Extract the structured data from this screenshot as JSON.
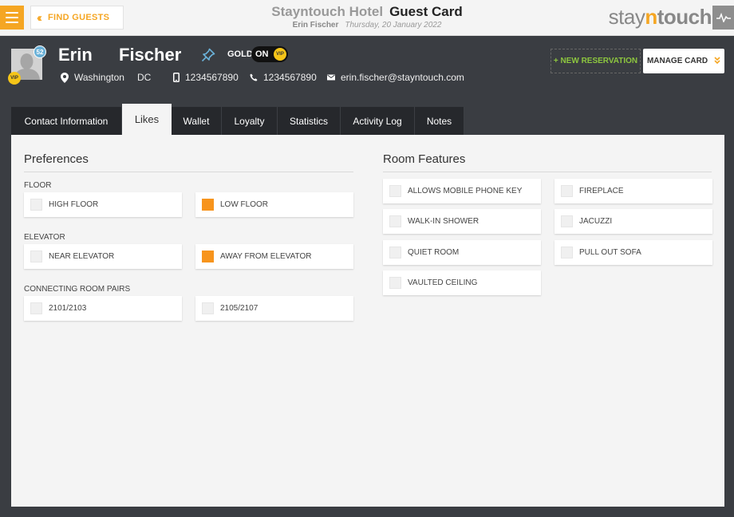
{
  "topbar": {
    "find_guests": "FIND GUESTS",
    "hotel_name": "Stayntouch Hotel",
    "card_title": "Guest Card",
    "guest_name": "Erin Fischer",
    "date": "Thursday, 20 January 2022",
    "logo_pre": "stay",
    "logo_mid": "n",
    "logo_post": "touch"
  },
  "guest": {
    "first_name": "Erin",
    "last_name": "Fischer",
    "stay_count": "52",
    "vip": "VIP",
    "membership": "GOLD",
    "toggle_state": "ON",
    "toggle_badge": "VIP",
    "city": "Washington",
    "state": "DC",
    "mobile": "1234567890",
    "phone": "1234567890",
    "email": "erin.fischer@stayntouch.com"
  },
  "actions": {
    "new_reservation": "+ NEW RESERVATION",
    "manage_card": "MANAGE CARD"
  },
  "tabs": [
    {
      "label": "Contact Information",
      "active": false
    },
    {
      "label": "Likes",
      "active": true
    },
    {
      "label": "Wallet",
      "active": false
    },
    {
      "label": "Loyalty",
      "active": false
    },
    {
      "label": "Statistics",
      "active": false
    },
    {
      "label": "Activity Log",
      "active": false
    },
    {
      "label": "Notes",
      "active": false
    }
  ],
  "preferences": {
    "title": "Preferences",
    "groups": [
      {
        "label": "FLOOR",
        "options": [
          {
            "label": "HIGH FLOOR",
            "checked": false
          },
          {
            "label": "LOW FLOOR",
            "checked": true
          }
        ]
      },
      {
        "label": "ELEVATOR",
        "options": [
          {
            "label": "NEAR ELEVATOR",
            "checked": false
          },
          {
            "label": "AWAY FROM ELEVATOR",
            "checked": true
          }
        ]
      },
      {
        "label": "CONNECTING ROOM PAIRS",
        "options": [
          {
            "label": "2101/2103",
            "checked": false
          },
          {
            "label": "2105/2107",
            "checked": false
          }
        ]
      }
    ]
  },
  "room_features": {
    "title": "Room Features",
    "options": [
      {
        "label": "ALLOWS MOBILE PHONE KEY",
        "checked": false
      },
      {
        "label": "FIREPLACE",
        "checked": false
      },
      {
        "label": "WALK-IN SHOWER",
        "checked": false
      },
      {
        "label": "JACUZZI",
        "checked": false
      },
      {
        "label": "QUIET ROOM",
        "checked": false
      },
      {
        "label": "PULL OUT SOFA",
        "checked": false
      },
      {
        "label": "VAULTED CEILING",
        "checked": false
      }
    ]
  },
  "colors": {
    "accent": "#f5a623",
    "checked": "#f7941d",
    "new_reservation": "#8dc63f",
    "header_bg": "#3a3d42"
  }
}
